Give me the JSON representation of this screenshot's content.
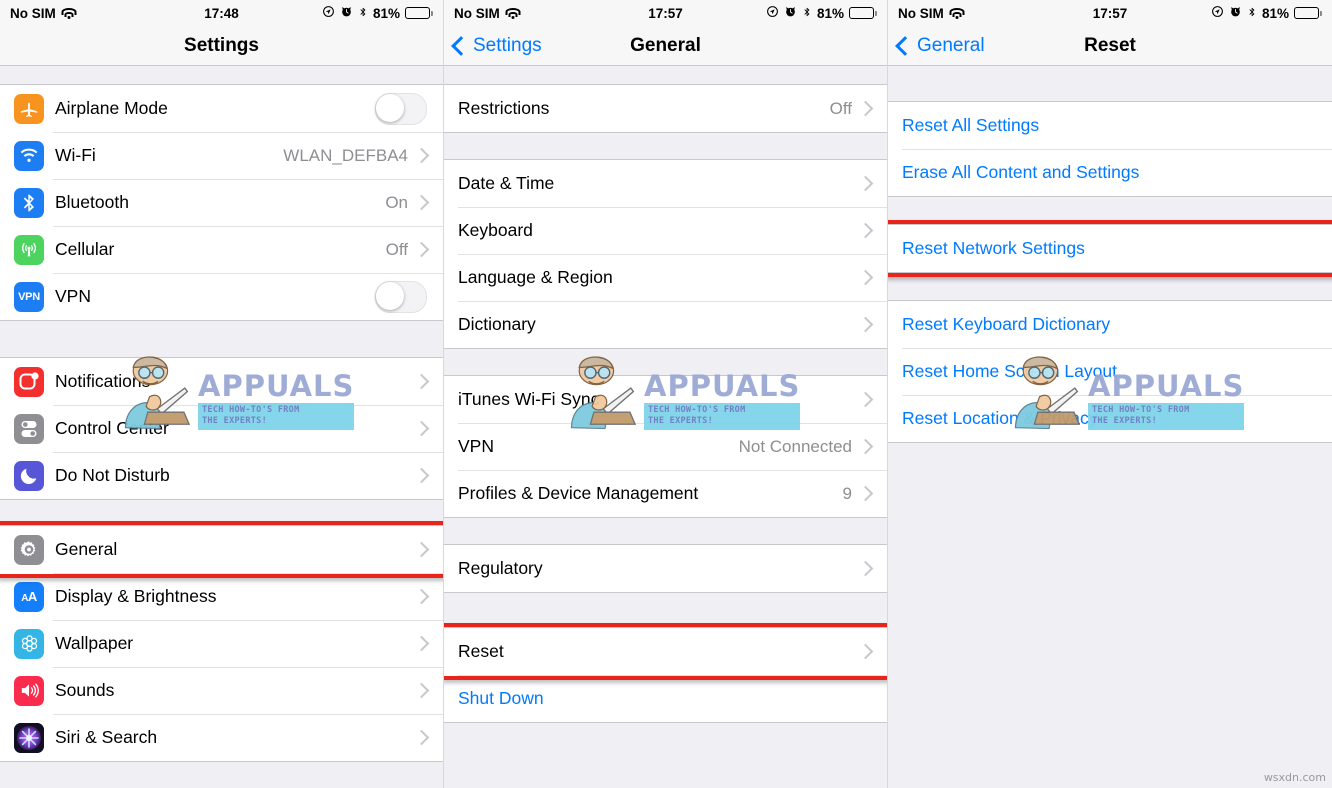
{
  "watermark": {
    "brand": "APPUALS",
    "tagline": "TECH HOW-TO'S FROM\nTHE EXPERTS!",
    "site": "wsxdn.com"
  },
  "panels": [
    {
      "status": {
        "carrier": "No SIM",
        "wifi_icon": "wifi-icon",
        "time": "17:48",
        "location_icon": "location-icon",
        "alarm_icon": "alarm-icon",
        "bluetooth_icon": "bluetooth-icon",
        "battery_pct": "81%",
        "battery_level": 81
      },
      "nav": {
        "title": "Settings",
        "back": null
      },
      "sections": [
        {
          "top_gap": 18,
          "rows": [
            {
              "label": "Airplane Mode",
              "icon": "airplane-icon",
              "icon_color": "#f7931e",
              "accessory": "toggle",
              "toggle_on": false
            },
            {
              "label": "Wi-Fi",
              "icon": "wifi-icon",
              "icon_color": "#1d7ef3",
              "value": "WLAN_DEFBA4",
              "accessory": "chevron"
            },
            {
              "label": "Bluetooth",
              "icon": "bluetooth-icon",
              "icon_color": "#1d7ef3",
              "value": "On",
              "accessory": "chevron"
            },
            {
              "label": "Cellular",
              "icon": "cellular-icon",
              "icon_color": "#4cd45e",
              "value": "Off",
              "accessory": "chevron"
            },
            {
              "label": "VPN",
              "icon": "vpn-icon",
              "icon_color": "#1d7ef3",
              "accessory": "toggle",
              "toggle_on": false
            }
          ]
        },
        {
          "top_gap": 36,
          "rows": [
            {
              "label": "Notifications",
              "icon": "notifications-icon",
              "icon_color": "#f4302e",
              "accessory": "chevron"
            },
            {
              "label": "Control Center",
              "icon": "control-center-icon",
              "icon_color": "#8e8e93",
              "accessory": "chevron"
            },
            {
              "label": "Do Not Disturb",
              "icon": "do-not-disturb-icon",
              "icon_color": "#5756d6",
              "accessory": "chevron"
            }
          ]
        },
        {
          "top_gap": 25,
          "rows": [
            {
              "label": "General",
              "icon": "general-gear-icon",
              "icon_color": "#8e8e93",
              "accessory": "chevron",
              "highlighted": true
            },
            {
              "label": "Display & Brightness",
              "icon": "display-brightness-icon",
              "icon_color": "#147efb",
              "accessory": "chevron"
            },
            {
              "label": "Wallpaper",
              "icon": "wallpaper-icon",
              "icon_color": "#33b5e5",
              "accessory": "chevron"
            },
            {
              "label": "Sounds",
              "icon": "sounds-icon",
              "icon_color": "#fb2b4d",
              "accessory": "chevron"
            },
            {
              "label": "Siri & Search",
              "icon": "siri-search-icon",
              "icon_color": "#1b1630",
              "accessory": "chevron"
            }
          ]
        }
      ]
    },
    {
      "status": {
        "carrier": "No SIM",
        "wifi_icon": "wifi-icon",
        "time": "17:57",
        "location_icon": "location-icon",
        "alarm_icon": "alarm-icon",
        "bluetooth_icon": "bluetooth-icon",
        "battery_pct": "81%",
        "battery_level": 81
      },
      "nav": {
        "title": "General",
        "back": "Settings"
      },
      "sections": [
        {
          "top_gap": 18,
          "rows": [
            {
              "label": "Restrictions",
              "value": "Off",
              "accessory": "chevron"
            }
          ]
        },
        {
          "top_gap": 26,
          "rows": [
            {
              "label": "Date & Time",
              "accessory": "chevron"
            },
            {
              "label": "Keyboard",
              "accessory": "chevron"
            },
            {
              "label": "Language & Region",
              "accessory": "chevron"
            },
            {
              "label": "Dictionary",
              "accessory": "chevron"
            }
          ]
        },
        {
          "top_gap": 26,
          "rows": [
            {
              "label": "iTunes Wi-Fi Sync",
              "accessory": "chevron"
            },
            {
              "label": "VPN",
              "value": "Not Connected",
              "accessory": "chevron"
            },
            {
              "label": "Profiles & Device Management",
              "value": "9",
              "accessory": "chevron"
            }
          ]
        },
        {
          "top_gap": 26,
          "rows": [
            {
              "label": "Regulatory",
              "accessory": "chevron"
            }
          ]
        },
        {
          "top_gap": 34,
          "rows": [
            {
              "label": "Reset",
              "accessory": "chevron",
              "highlighted": true
            },
            {
              "label": "Shut Down",
              "style": "blue"
            }
          ]
        }
      ]
    },
    {
      "status": {
        "carrier": "No SIM",
        "wifi_icon": "wifi-icon",
        "time": "17:57",
        "location_icon": "location-icon",
        "alarm_icon": "alarm-icon",
        "bluetooth_icon": "bluetooth-icon",
        "battery_pct": "81%",
        "battery_level": 81
      },
      "nav": {
        "title": "Reset",
        "back": "General"
      },
      "sections": [
        {
          "top_gap": 35,
          "rows": [
            {
              "label": "Reset All Settings",
              "style": "blue"
            },
            {
              "label": "Erase All Content and Settings",
              "style": "blue"
            }
          ]
        },
        {
          "top_gap": 27,
          "rows": [
            {
              "label": "Reset Network Settings",
              "style": "blue",
              "highlighted": true
            }
          ]
        },
        {
          "top_gap": 27,
          "rows": [
            {
              "label": "Reset Keyboard Dictionary",
              "style": "blue"
            },
            {
              "label": "Reset Home Screen Layout",
              "style": "blue"
            },
            {
              "label": "Reset Location & Privacy",
              "style": "blue"
            }
          ]
        }
      ]
    }
  ]
}
